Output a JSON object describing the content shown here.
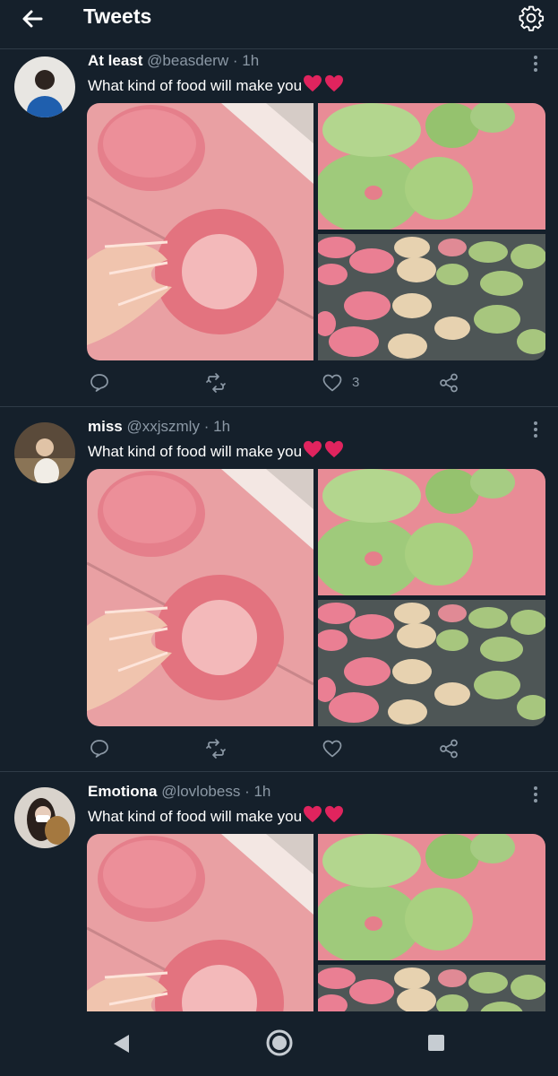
{
  "header": {
    "title": "Tweets"
  },
  "tweets": [
    {
      "name": "At least",
      "handle": "@beasderw",
      "time": "1h",
      "text": "What kind of food will make you",
      "like_count": "3"
    },
    {
      "name": "miss",
      "handle": "@xxjszmly",
      "time": "1h",
      "text": "What kind of food will make you",
      "like_count": ""
    },
    {
      "name": "Emotiona",
      "handle": "@lovlobess",
      "time": "1h",
      "text": "What kind of food will make you",
      "like_count": ""
    }
  ],
  "separator": "·",
  "icons": [
    "back-arrow-icon",
    "gear-icon",
    "more-icon",
    "reply-icon",
    "retweet-icon",
    "heart-icon",
    "share-icon",
    "nav-back-icon",
    "nav-home-icon",
    "nav-recents-icon"
  ],
  "colors": {
    "background": "#15202b",
    "secondary_text": "#8b98a5",
    "heart_emoji": "#e0245e"
  }
}
